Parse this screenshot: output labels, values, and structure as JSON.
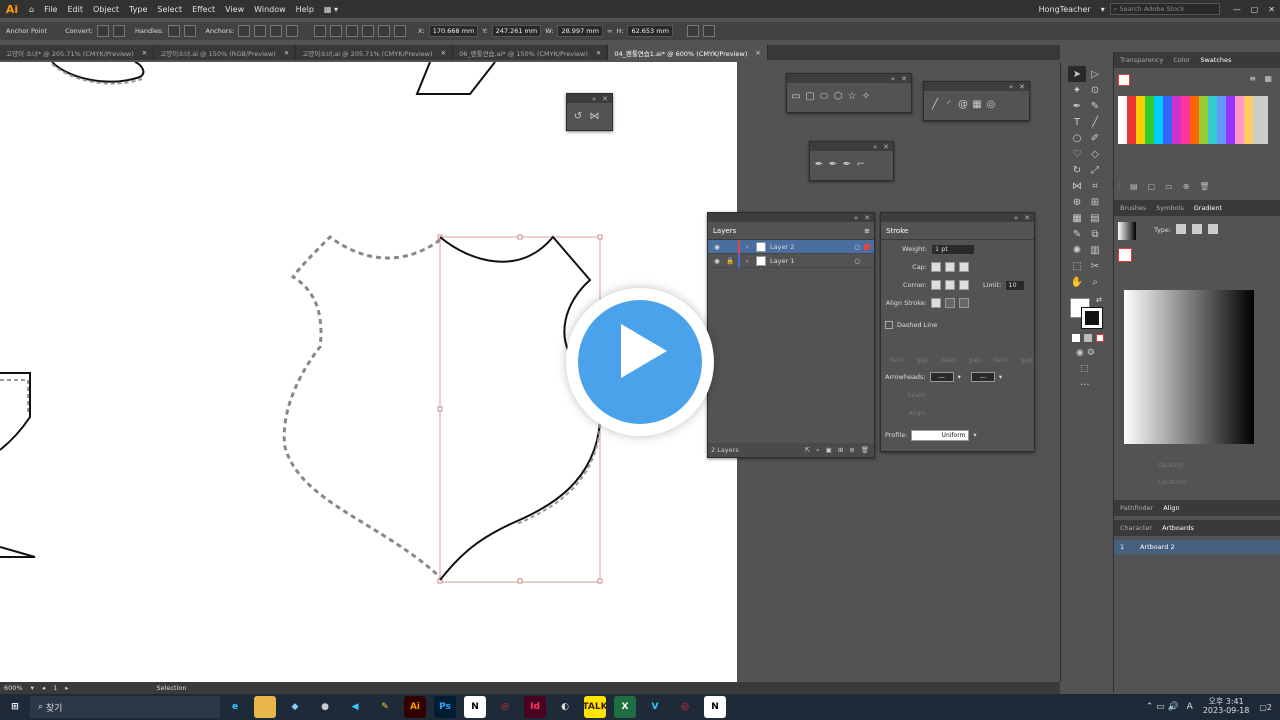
{
  "menubar": {
    "logo": "Ai",
    "items": [
      "File",
      "Edit",
      "Object",
      "Type",
      "Select",
      "Effect",
      "View",
      "Window",
      "Help"
    ],
    "user": "HongTeacher",
    "search_placeholder": "Search Adobe Stock"
  },
  "control": {
    "tool_label": "Anchor Point",
    "convert_label": "Convert:",
    "handles_label": "Handles:",
    "anchors_label": "Anchors:",
    "x_label": "X:",
    "x_value": "170.668 mm",
    "y_label": "Y:",
    "y_value": "247.261 mm",
    "w_label": "W:",
    "w_value": "28.997 mm",
    "h_label": "H:",
    "h_value": "62.653 mm"
  },
  "tabs": [
    {
      "label": "고양이 소녀* @ 205.71% (CMYK/Preview)",
      "active": false
    },
    {
      "label": "고양이소녀.ai @ 150% (RGB/Preview)",
      "active": false
    },
    {
      "label": "고양이소녀.ai @ 205.71% (CMYK/Preview)",
      "active": false
    },
    {
      "label": "06_펜툴연습.ai* @ 150% (CMYK/Preview)",
      "active": false
    },
    {
      "label": "04_펜툴연습1.ai* @ 600% (CMYK/Preview)",
      "active": true
    }
  ],
  "layers": {
    "title": "Layers",
    "rows": [
      {
        "name": "Layer 2",
        "selected": true,
        "color": "#e04545"
      },
      {
        "name": "Layer 1",
        "selected": false,
        "color": "#4a6ee0"
      }
    ],
    "footer": "2 Layers"
  },
  "stroke": {
    "title": "Stroke",
    "weight_label": "Weight:",
    "weight_value": "1 pt",
    "cap_label": "Cap:",
    "corner_label": "Corner:",
    "limit_label": "Limit:",
    "limit_value": "10",
    "align_label": "Align Stroke:",
    "dashed_label": "Dashed Line",
    "dash_labels": [
      "dash",
      "gap",
      "dash",
      "gap",
      "dash",
      "gap"
    ],
    "arrowheads_label": "Arrowheads:",
    "scale_label": "Scale:",
    "align2_label": "Align:",
    "profile_label": "Profile:",
    "profile_value": "Uniform"
  },
  "right": {
    "tabs1": [
      "Transparency",
      "Color",
      "Swatches"
    ],
    "tabs2": [
      "Brushes",
      "Symbols",
      "Gradient"
    ],
    "type_label": "Type:",
    "opacity_label": "Opacity:",
    "location_label": "Location:",
    "tabs3": [
      "Pathfinder",
      "Align"
    ],
    "tabs4": [
      "Character",
      "Artboards"
    ],
    "artboard_index": "1",
    "artboard_name": "Artboard 2"
  },
  "status": {
    "zoom": "600%",
    "artboard": "1",
    "tool": "Selection"
  },
  "taskbar": {
    "search": "찾기",
    "time": "오후 3:41",
    "date": "2023-09-18",
    "lang": "A",
    "notif": "2"
  }
}
